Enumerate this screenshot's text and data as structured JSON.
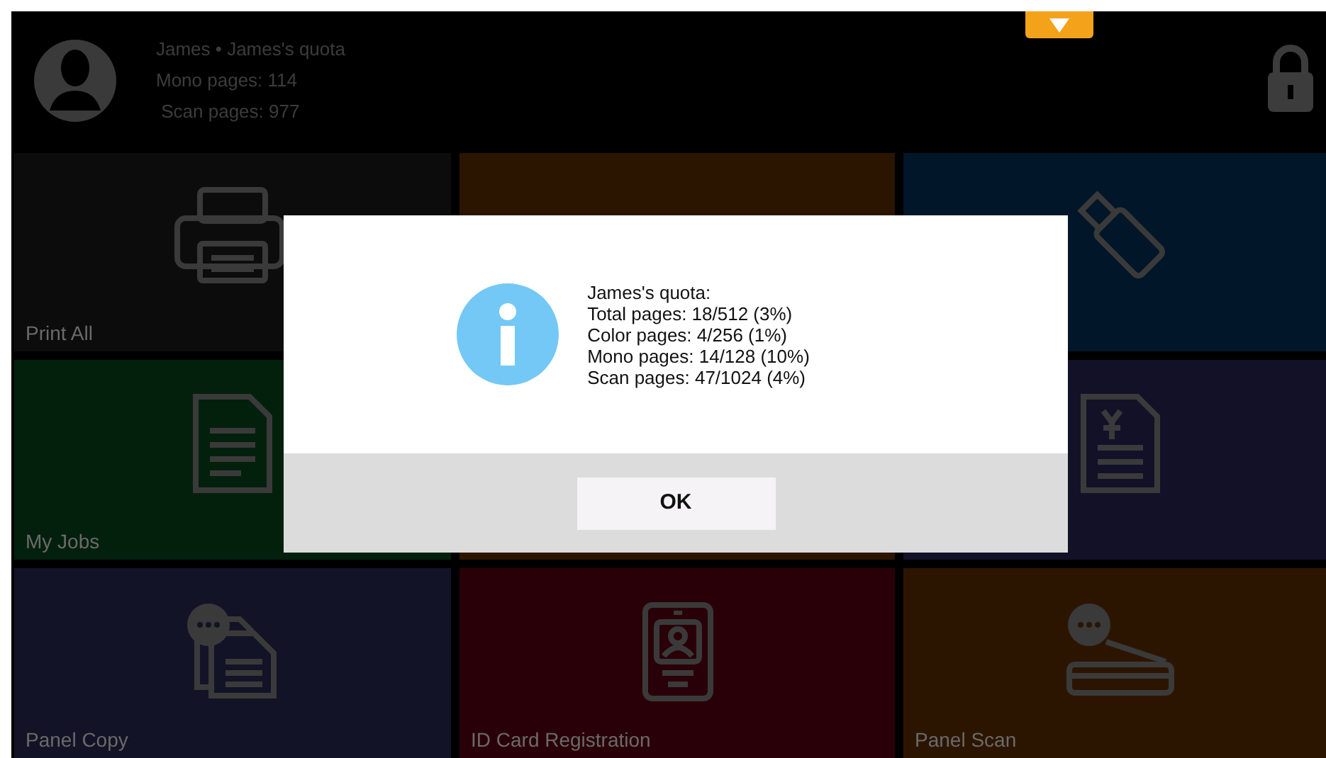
{
  "header": {
    "user_line": "James • James's quota",
    "quota_lines": [
      "Mono pages: 114",
      " Scan pages: 977"
    ],
    "locked": true
  },
  "tiles": [
    {
      "label": "Print All",
      "color": "#0c0c0c",
      "kind": "printer"
    },
    {
      "color": "#2c1500",
      "kind": "blank"
    },
    {
      "color": "#02162a",
      "kind": "usb"
    },
    {
      "label": "My Jobs",
      "color": "#03200c",
      "kind": "document"
    },
    {
      "color": "#2c1500",
      "kind": "blank"
    },
    {
      "color": "#121128",
      "kind": "invoice"
    },
    {
      "label": "Panel Copy",
      "color": "#121326",
      "kind": "copy"
    },
    {
      "label": "ID Card Registration",
      "color": "#2a0008",
      "kind": "idcard"
    },
    {
      "label": "Panel Scan",
      "color": "#2c1500",
      "kind": "scanner"
    }
  ],
  "dialog": {
    "lines": [
      "James's quota:",
      "Total pages: 18/512 (3%)",
      "Color pages: 4/256 (1%)",
      "Mono pages: 14/128 (10%)",
      "Scan pages: 47/1024 (4%)"
    ],
    "button": "OK"
  }
}
